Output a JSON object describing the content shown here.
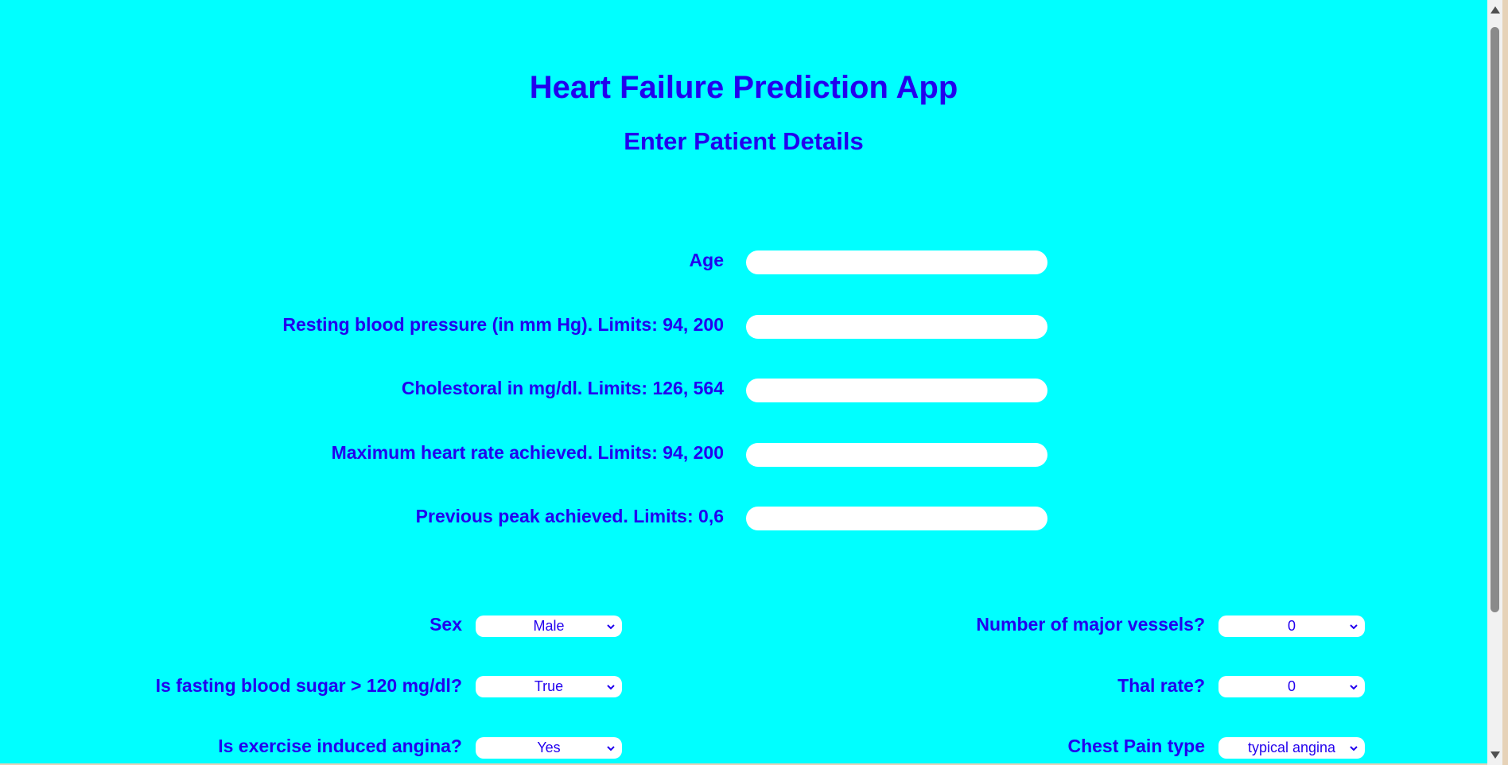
{
  "header": {
    "title": "Heart Failure Prediction App",
    "subtitle": "Enter Patient Details"
  },
  "numeric_fields": [
    {
      "label": "Age",
      "value": ""
    },
    {
      "label": "Resting blood pressure (in mm Hg). Limits: 94, 200",
      "value": ""
    },
    {
      "label": "Cholestoral in mg/dl. Limits: 126, 564",
      "value": ""
    },
    {
      "label": "Maximum heart rate achieved. Limits: 94, 200",
      "value": ""
    },
    {
      "label": "Previous peak achieved. Limits: 0,6",
      "value": ""
    }
  ],
  "left_selects": [
    {
      "label": "Sex",
      "value": "Male"
    },
    {
      "label": "Is fasting blood sugar > 120 mg/dl?",
      "value": "True"
    },
    {
      "label": "Is exercise induced angina?",
      "value": "Yes"
    }
  ],
  "right_selects": [
    {
      "label": "Number of major vessels?",
      "value": "0"
    },
    {
      "label": "Thal rate?",
      "value": "0"
    },
    {
      "label": "Chest Pain type",
      "value": "typical angina"
    }
  ],
  "icons": {
    "dropdown": "chevron-down-icon",
    "scroll_up": "scroll-up-arrow-icon",
    "scroll_down": "scroll-down-arrow-icon"
  },
  "colors": {
    "background": "#00ffff",
    "text": "#2200ee",
    "field": "#ffffff"
  }
}
